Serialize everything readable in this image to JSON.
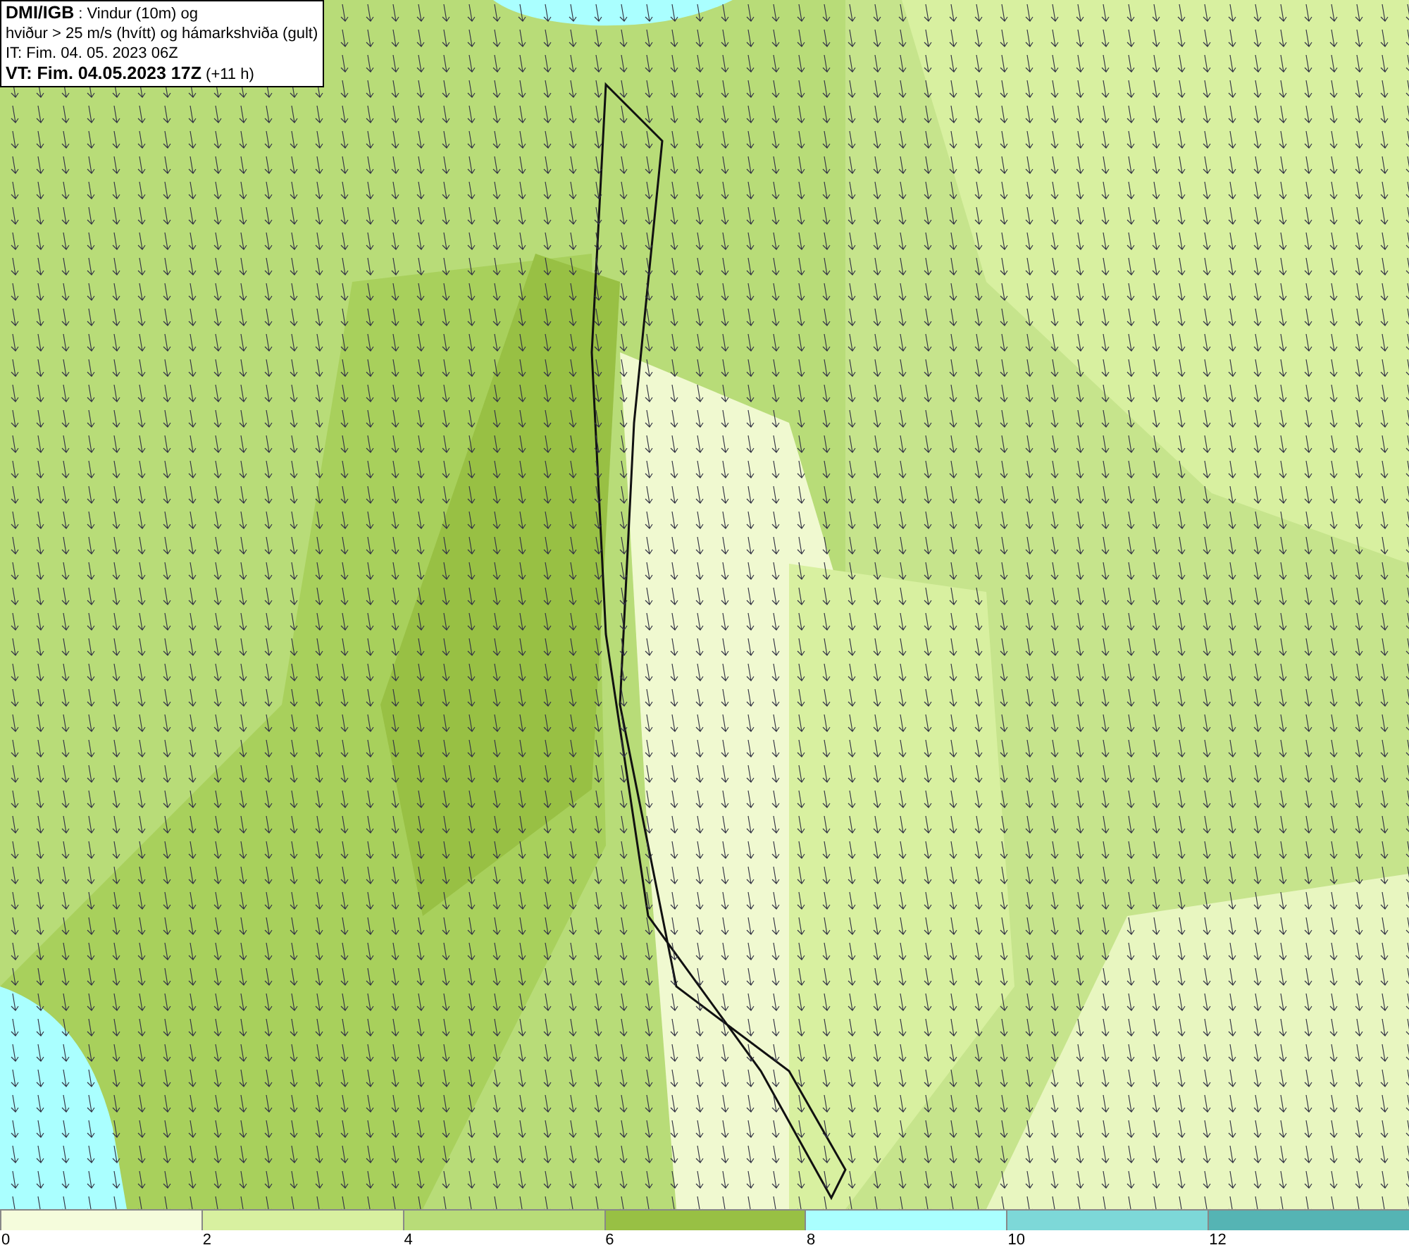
{
  "header": {
    "lines": [
      "**DMI/IGB** : Vindur (10m) og",
      "hviður > 25 m/s (hvítt) og hámarkshviða (gult)",
      "IT: Fim. 04. 05. 2023 06Z",
      "**VT: Fim. 04.05.2023 17Z** (+11 h)"
    ]
  },
  "legend": {
    "segments": [
      {
        "label": "0",
        "color": "#f5fcdc"
      },
      {
        "label": "2",
        "color": "#d8f0a0"
      },
      {
        "label": "4",
        "color": "#b8dc78"
      },
      {
        "label": "6",
        "color": "#98c044"
      },
      {
        "label": "8",
        "color": "#aaffff"
      },
      {
        "label": "10",
        "color": "#7dd8d8"
      },
      {
        "label": "12",
        "color": "#55b4b4"
      }
    ]
  }
}
